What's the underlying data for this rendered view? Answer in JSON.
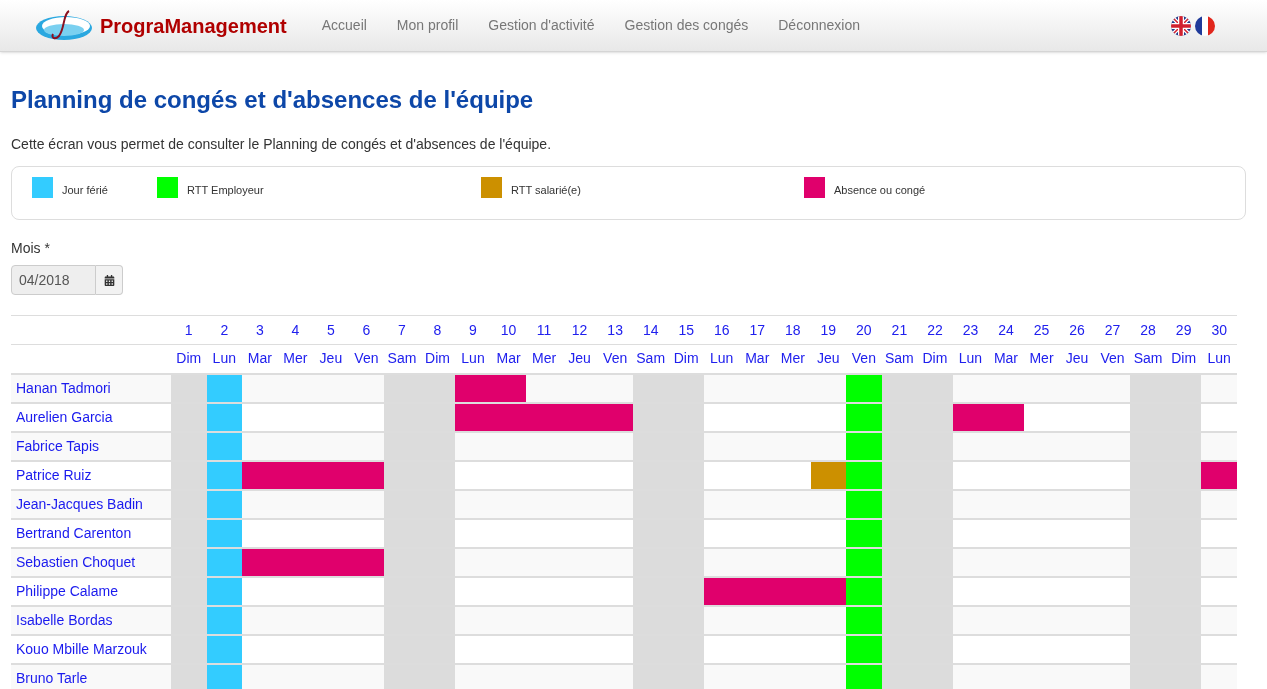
{
  "brand": "PrograManagement",
  "nav": [
    "Accueil",
    "Mon profil",
    "Gestion d'activité",
    "Gestion des congés",
    "Déconnexion"
  ],
  "title": "Planning de congés et d'absences de l'équipe",
  "intro": "Cette écran vous permet de consulter le Planning de congés et d'absences de l'équipe.",
  "legend": [
    {
      "label": "Jour férié",
      "kind": "holiday",
      "color": "#33ccff"
    },
    {
      "label": "RTT Employeur",
      "kind": "employer",
      "color": "#00ff00"
    },
    {
      "label": "RTT salarié(e)",
      "kind": "employee",
      "color": "#cc9000"
    },
    {
      "label": "Absence ou congé",
      "kind": "absence",
      "color": "#e0006c"
    }
  ],
  "month": {
    "label": "Mois *",
    "value": "04/2018"
  },
  "days": [
    {
      "num": "1",
      "day": "Dim"
    },
    {
      "num": "2",
      "day": "Lun"
    },
    {
      "num": "3",
      "day": "Mar"
    },
    {
      "num": "4",
      "day": "Mer"
    },
    {
      "num": "5",
      "day": "Jeu"
    },
    {
      "num": "6",
      "day": "Ven"
    },
    {
      "num": "7",
      "day": "Sam"
    },
    {
      "num": "8",
      "day": "Dim"
    },
    {
      "num": "9",
      "day": "Lun"
    },
    {
      "num": "10",
      "day": "Mar"
    },
    {
      "num": "11",
      "day": "Mer"
    },
    {
      "num": "12",
      "day": "Jeu"
    },
    {
      "num": "13",
      "day": "Ven"
    },
    {
      "num": "14",
      "day": "Sam"
    },
    {
      "num": "15",
      "day": "Dim"
    },
    {
      "num": "16",
      "day": "Lun"
    },
    {
      "num": "17",
      "day": "Mar"
    },
    {
      "num": "18",
      "day": "Mer"
    },
    {
      "num": "19",
      "day": "Jeu"
    },
    {
      "num": "20",
      "day": "Ven"
    },
    {
      "num": "21",
      "day": "Sam"
    },
    {
      "num": "22",
      "day": "Dim"
    },
    {
      "num": "23",
      "day": "Lun"
    },
    {
      "num": "24",
      "day": "Mar"
    },
    {
      "num": "25",
      "day": "Mer"
    },
    {
      "num": "26",
      "day": "Jeu"
    },
    {
      "num": "27",
      "day": "Ven"
    },
    {
      "num": "28",
      "day": "Sam"
    },
    {
      "num": "29",
      "day": "Dim"
    },
    {
      "num": "30",
      "day": "Lun"
    }
  ],
  "rows": [
    {
      "name": "Hanan Tadmori",
      "cells": [
        {
          "kind": "off"
        },
        {
          "kind": "holiday"
        },
        {
          "kind": "work"
        },
        {
          "kind": "work"
        },
        {
          "kind": "work"
        },
        {
          "kind": "work"
        },
        {
          "kind": "off"
        },
        {
          "kind": "off"
        },
        {
          "kind": "absence"
        },
        {
          "kind": "absence"
        },
        {
          "kind": "work"
        },
        {
          "kind": "work"
        },
        {
          "kind": "work"
        },
        {
          "kind": "off"
        },
        {
          "kind": "off"
        },
        {
          "kind": "work"
        },
        {
          "kind": "work"
        },
        {
          "kind": "work"
        },
        {
          "kind": "work"
        },
        {
          "kind": "employer"
        },
        {
          "kind": "off"
        },
        {
          "kind": "off"
        },
        {
          "kind": "work"
        },
        {
          "kind": "work"
        },
        {
          "kind": "work"
        },
        {
          "kind": "work"
        },
        {
          "kind": "work"
        },
        {
          "kind": "off"
        },
        {
          "kind": "off"
        },
        {
          "kind": "work"
        }
      ]
    },
    {
      "name": "Aurelien Garcia",
      "cells": [
        {
          "kind": "off"
        },
        {
          "kind": "holiday"
        },
        {
          "kind": "work"
        },
        {
          "kind": "work"
        },
        {
          "kind": "work"
        },
        {
          "kind": "work"
        },
        {
          "kind": "off"
        },
        {
          "kind": "off"
        },
        {
          "kind": "absence"
        },
        {
          "kind": "absence"
        },
        {
          "kind": "absence"
        },
        {
          "kind": "absence"
        },
        {
          "kind": "absence"
        },
        {
          "kind": "off"
        },
        {
          "kind": "off"
        },
        {
          "kind": "work"
        },
        {
          "kind": "work"
        },
        {
          "kind": "work"
        },
        {
          "kind": "work"
        },
        {
          "kind": "employer"
        },
        {
          "kind": "off"
        },
        {
          "kind": "off"
        },
        {
          "kind": "absence"
        },
        {
          "kind": "absence"
        },
        {
          "kind": "work"
        },
        {
          "kind": "work"
        },
        {
          "kind": "work"
        },
        {
          "kind": "off"
        },
        {
          "kind": "off"
        },
        {
          "kind": "work"
        }
      ]
    },
    {
      "name": "Fabrice Tapis",
      "cells": [
        {
          "kind": "off"
        },
        {
          "kind": "holiday"
        },
        {
          "kind": "work"
        },
        {
          "kind": "work"
        },
        {
          "kind": "work"
        },
        {
          "kind": "work"
        },
        {
          "kind": "off"
        },
        {
          "kind": "off"
        },
        {
          "kind": "work"
        },
        {
          "kind": "work"
        },
        {
          "kind": "work"
        },
        {
          "kind": "work"
        },
        {
          "kind": "work"
        },
        {
          "kind": "off"
        },
        {
          "kind": "off"
        },
        {
          "kind": "work"
        },
        {
          "kind": "work"
        },
        {
          "kind": "work"
        },
        {
          "kind": "work"
        },
        {
          "kind": "employer"
        },
        {
          "kind": "off"
        },
        {
          "kind": "off"
        },
        {
          "kind": "work"
        },
        {
          "kind": "work"
        },
        {
          "kind": "work"
        },
        {
          "kind": "work"
        },
        {
          "kind": "work"
        },
        {
          "kind": "off"
        },
        {
          "kind": "off"
        },
        {
          "kind": "work"
        }
      ]
    },
    {
      "name": "Patrice Ruiz",
      "cells": [
        {
          "kind": "off"
        },
        {
          "kind": "holiday"
        },
        {
          "kind": "absence"
        },
        {
          "kind": "absence"
        },
        {
          "kind": "absence"
        },
        {
          "kind": "absence"
        },
        {
          "kind": "off"
        },
        {
          "kind": "off"
        },
        {
          "kind": "work"
        },
        {
          "kind": "work"
        },
        {
          "kind": "work"
        },
        {
          "kind": "work"
        },
        {
          "kind": "work"
        },
        {
          "kind": "off"
        },
        {
          "kind": "off"
        },
        {
          "kind": "work"
        },
        {
          "kind": "work"
        },
        {
          "kind": "work"
        },
        {
          "kind": "employee"
        },
        {
          "kind": "employer"
        },
        {
          "kind": "off"
        },
        {
          "kind": "off"
        },
        {
          "kind": "work"
        },
        {
          "kind": "work"
        },
        {
          "kind": "work"
        },
        {
          "kind": "work"
        },
        {
          "kind": "work"
        },
        {
          "kind": "off"
        },
        {
          "kind": "off"
        },
        {
          "kind": "absence"
        }
      ]
    },
    {
      "name": "Jean-Jacques Badin",
      "cells": [
        {
          "kind": "off"
        },
        {
          "kind": "holiday"
        },
        {
          "kind": "work"
        },
        {
          "kind": "work"
        },
        {
          "kind": "work"
        },
        {
          "kind": "work"
        },
        {
          "kind": "off"
        },
        {
          "kind": "off"
        },
        {
          "kind": "work"
        },
        {
          "kind": "work"
        },
        {
          "kind": "work"
        },
        {
          "kind": "work"
        },
        {
          "kind": "work"
        },
        {
          "kind": "off"
        },
        {
          "kind": "off"
        },
        {
          "kind": "work"
        },
        {
          "kind": "work"
        },
        {
          "kind": "work"
        },
        {
          "kind": "work"
        },
        {
          "kind": "employer"
        },
        {
          "kind": "off"
        },
        {
          "kind": "off"
        },
        {
          "kind": "work"
        },
        {
          "kind": "work"
        },
        {
          "kind": "work"
        },
        {
          "kind": "work"
        },
        {
          "kind": "work"
        },
        {
          "kind": "off"
        },
        {
          "kind": "off"
        },
        {
          "kind": "work"
        }
      ]
    },
    {
      "name": "Bertrand Carenton",
      "cells": [
        {
          "kind": "off"
        },
        {
          "kind": "holiday"
        },
        {
          "kind": "work"
        },
        {
          "kind": "work"
        },
        {
          "kind": "work"
        },
        {
          "kind": "work"
        },
        {
          "kind": "off"
        },
        {
          "kind": "off"
        },
        {
          "kind": "work"
        },
        {
          "kind": "work"
        },
        {
          "kind": "work"
        },
        {
          "kind": "work"
        },
        {
          "kind": "work"
        },
        {
          "kind": "off"
        },
        {
          "kind": "off"
        },
        {
          "kind": "work"
        },
        {
          "kind": "work"
        },
        {
          "kind": "work"
        },
        {
          "kind": "work"
        },
        {
          "kind": "employer"
        },
        {
          "kind": "off"
        },
        {
          "kind": "off"
        },
        {
          "kind": "work"
        },
        {
          "kind": "work"
        },
        {
          "kind": "work"
        },
        {
          "kind": "work"
        },
        {
          "kind": "work"
        },
        {
          "kind": "off"
        },
        {
          "kind": "off"
        },
        {
          "kind": "work"
        }
      ]
    },
    {
      "name": "Sebastien Choquet",
      "cells": [
        {
          "kind": "off"
        },
        {
          "kind": "holiday"
        },
        {
          "kind": "absence"
        },
        {
          "kind": "absence"
        },
        {
          "kind": "absence"
        },
        {
          "kind": "absence"
        },
        {
          "kind": "off"
        },
        {
          "kind": "off"
        },
        {
          "kind": "work"
        },
        {
          "kind": "work"
        },
        {
          "kind": "work"
        },
        {
          "kind": "work"
        },
        {
          "kind": "work"
        },
        {
          "kind": "off"
        },
        {
          "kind": "off"
        },
        {
          "kind": "work"
        },
        {
          "kind": "work"
        },
        {
          "kind": "work"
        },
        {
          "kind": "work"
        },
        {
          "kind": "employer"
        },
        {
          "kind": "off"
        },
        {
          "kind": "off"
        },
        {
          "kind": "work"
        },
        {
          "kind": "work"
        },
        {
          "kind": "work"
        },
        {
          "kind": "work"
        },
        {
          "kind": "work"
        },
        {
          "kind": "off"
        },
        {
          "kind": "off"
        },
        {
          "kind": "work"
        }
      ]
    },
    {
      "name": "Philippe Calame",
      "cells": [
        {
          "kind": "off"
        },
        {
          "kind": "holiday"
        },
        {
          "kind": "work"
        },
        {
          "kind": "work"
        },
        {
          "kind": "work"
        },
        {
          "kind": "work"
        },
        {
          "kind": "off"
        },
        {
          "kind": "off"
        },
        {
          "kind": "work"
        },
        {
          "kind": "work"
        },
        {
          "kind": "work"
        },
        {
          "kind": "work"
        },
        {
          "kind": "work"
        },
        {
          "kind": "off"
        },
        {
          "kind": "off"
        },
        {
          "kind": "absence"
        },
        {
          "kind": "absence"
        },
        {
          "kind": "absence"
        },
        {
          "kind": "absence"
        },
        {
          "kind": "employer"
        },
        {
          "kind": "off"
        },
        {
          "kind": "off"
        },
        {
          "kind": "work"
        },
        {
          "kind": "work"
        },
        {
          "kind": "work"
        },
        {
          "kind": "work"
        },
        {
          "kind": "work"
        },
        {
          "kind": "off"
        },
        {
          "kind": "off"
        },
        {
          "kind": "work"
        }
      ]
    },
    {
      "name": "Isabelle Bordas",
      "cells": [
        {
          "kind": "off"
        },
        {
          "kind": "holiday"
        },
        {
          "kind": "work"
        },
        {
          "kind": "work"
        },
        {
          "kind": "work"
        },
        {
          "kind": "work"
        },
        {
          "kind": "off"
        },
        {
          "kind": "off"
        },
        {
          "kind": "work"
        },
        {
          "kind": "work"
        },
        {
          "kind": "work"
        },
        {
          "kind": "work"
        },
        {
          "kind": "work"
        },
        {
          "kind": "off"
        },
        {
          "kind": "off"
        },
        {
          "kind": "work"
        },
        {
          "kind": "work"
        },
        {
          "kind": "work"
        },
        {
          "kind": "work"
        },
        {
          "kind": "employer"
        },
        {
          "kind": "off"
        },
        {
          "kind": "off"
        },
        {
          "kind": "work"
        },
        {
          "kind": "work"
        },
        {
          "kind": "work"
        },
        {
          "kind": "work"
        },
        {
          "kind": "work"
        },
        {
          "kind": "off"
        },
        {
          "kind": "off"
        },
        {
          "kind": "work"
        }
      ]
    },
    {
      "name": "Kouo Mbille Marzouk",
      "cells": [
        {
          "kind": "off"
        },
        {
          "kind": "holiday"
        },
        {
          "kind": "work"
        },
        {
          "kind": "work"
        },
        {
          "kind": "work"
        },
        {
          "kind": "work"
        },
        {
          "kind": "off"
        },
        {
          "kind": "off"
        },
        {
          "kind": "work"
        },
        {
          "kind": "work"
        },
        {
          "kind": "work"
        },
        {
          "kind": "work"
        },
        {
          "kind": "work"
        },
        {
          "kind": "off"
        },
        {
          "kind": "off"
        },
        {
          "kind": "work"
        },
        {
          "kind": "work"
        },
        {
          "kind": "work"
        },
        {
          "kind": "work"
        },
        {
          "kind": "employer"
        },
        {
          "kind": "off"
        },
        {
          "kind": "off"
        },
        {
          "kind": "work"
        },
        {
          "kind": "work"
        },
        {
          "kind": "work"
        },
        {
          "kind": "work"
        },
        {
          "kind": "work"
        },
        {
          "kind": "off"
        },
        {
          "kind": "off"
        },
        {
          "kind": "work"
        }
      ]
    },
    {
      "name": "Bruno Tarle",
      "cells": [
        {
          "kind": "off"
        },
        {
          "kind": "holiday"
        },
        {
          "kind": "work"
        },
        {
          "kind": "work"
        },
        {
          "kind": "work"
        },
        {
          "kind": "work"
        },
        {
          "kind": "off"
        },
        {
          "kind": "off"
        },
        {
          "kind": "work"
        },
        {
          "kind": "work"
        },
        {
          "kind": "work"
        },
        {
          "kind": "work"
        },
        {
          "kind": "work"
        },
        {
          "kind": "off"
        },
        {
          "kind": "off"
        },
        {
          "kind": "work"
        },
        {
          "kind": "work"
        },
        {
          "kind": "work"
        },
        {
          "kind": "work"
        },
        {
          "kind": "employer"
        },
        {
          "kind": "off"
        },
        {
          "kind": "off"
        },
        {
          "kind": "work"
        },
        {
          "kind": "work"
        },
        {
          "kind": "work"
        },
        {
          "kind": "work"
        },
        {
          "kind": "work"
        },
        {
          "kind": "off"
        },
        {
          "kind": "off"
        },
        {
          "kind": "work"
        }
      ]
    }
  ]
}
